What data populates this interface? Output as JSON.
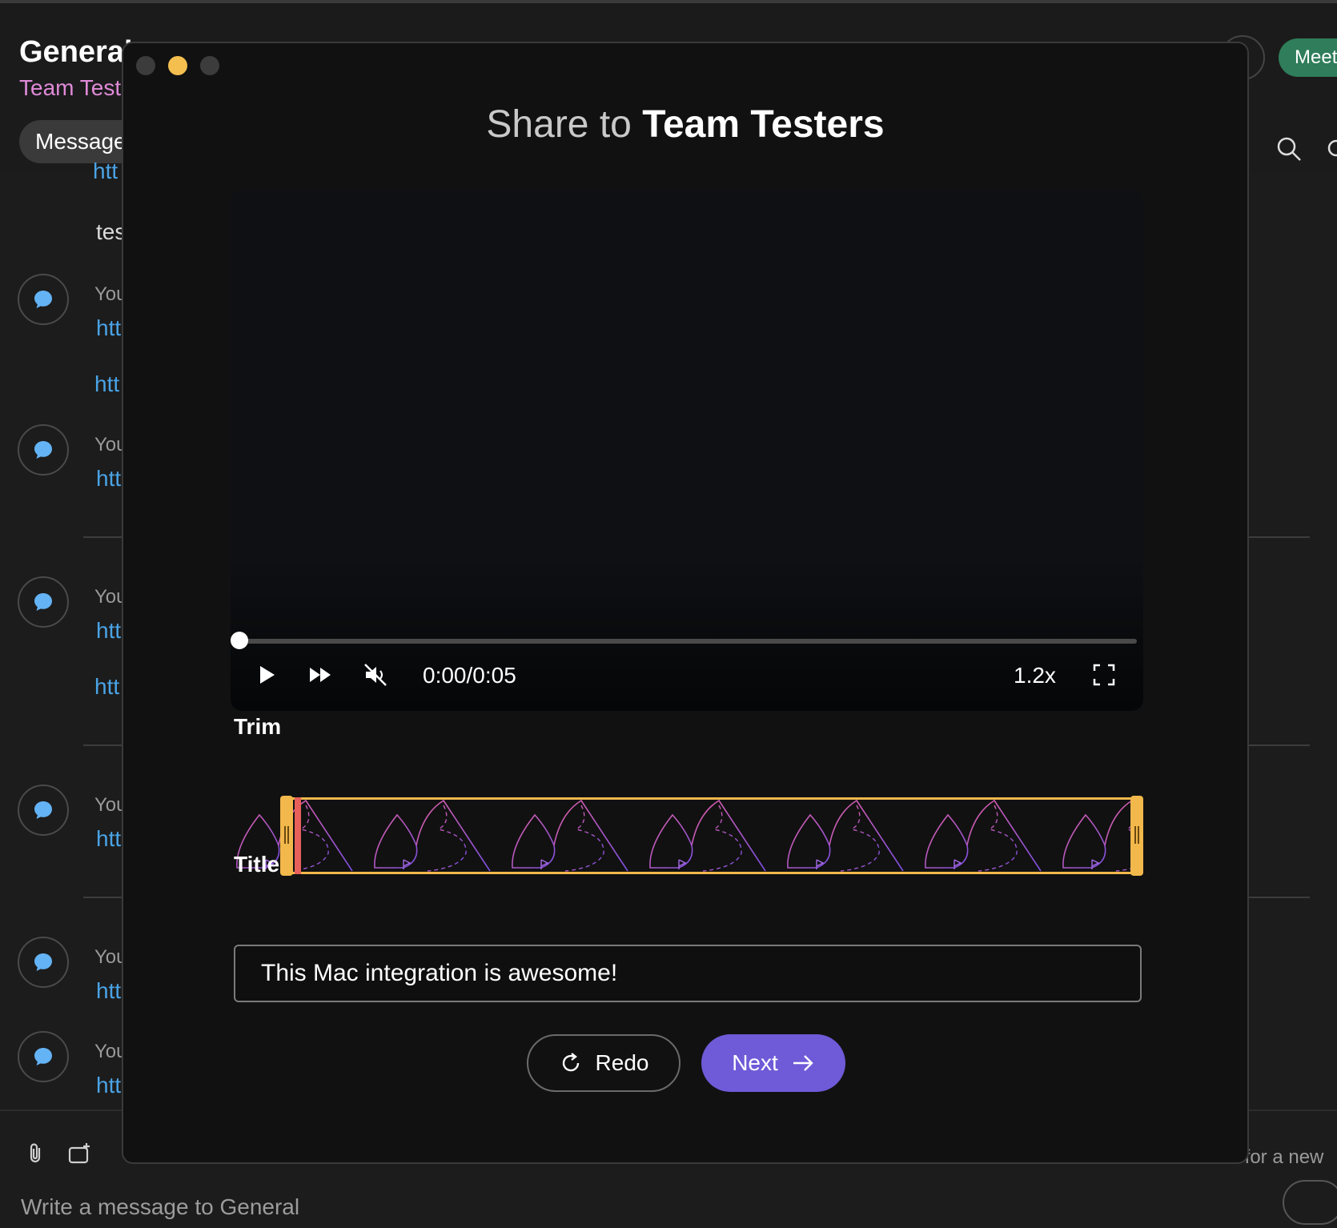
{
  "background": {
    "space_title": "General",
    "space_subtitle": "Team Testers",
    "tab_messages": "Messages",
    "meet_button": "Meet",
    "truncated_text": "tes",
    "sender": "You",
    "link_prefix": "htt",
    "composer_placeholder": "Write a message to General",
    "composer_hint": "r for a new"
  },
  "modal": {
    "title_prefix": "Share to",
    "title_target": "Team Testers",
    "player": {
      "time": "0:00/0:05",
      "speed": "1.2x",
      "progress": 0
    },
    "trim_label": "Trim",
    "title_label": "Title",
    "title_value": "This Mac integration is awesome!",
    "redo_label": "Redo",
    "next_label": "Next"
  },
  "colors": {
    "accent": "#6f5ad8",
    "trim": "#f2b84b",
    "playhead": "#e8605a",
    "link": "#4aa3e6",
    "subtitle": "#e08ad8"
  }
}
